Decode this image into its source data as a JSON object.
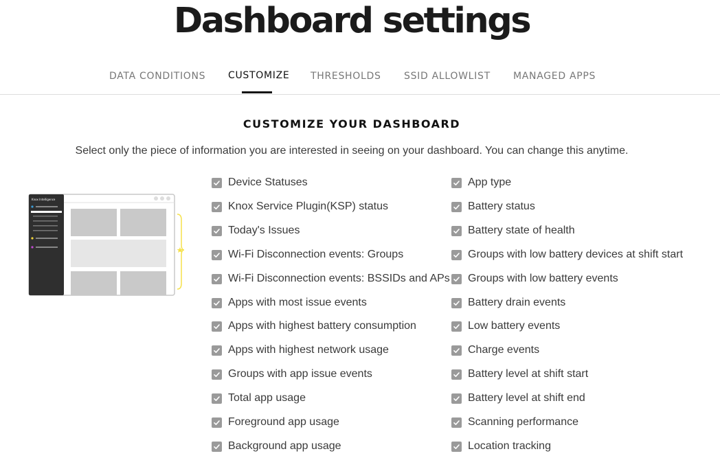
{
  "page": {
    "title": "Dashboard settings"
  },
  "tabs": [
    {
      "label": "DATA CONDITIONS",
      "active": false
    },
    {
      "label": "CUSTOMIZE",
      "active": true
    },
    {
      "label": "THRESHOLDS",
      "active": false
    },
    {
      "label": "SSID ALLOWLIST",
      "active": false
    },
    {
      "label": "MANAGED APPS",
      "active": false
    }
  ],
  "section": {
    "title": "CUSTOMIZE YOUR DASHBOARD",
    "subtitle": "Select only the piece of information you are interested in seeing on your dashboard. You can change this anytime."
  },
  "illustration": {
    "app_label": "Knox Intelligence",
    "icon": "dashboard-preview-icon"
  },
  "options_left": [
    {
      "label": "Device Statuses",
      "checked": true
    },
    {
      "label": "Knox Service Plugin(KSP) status",
      "checked": true
    },
    {
      "label": "Today's Issues",
      "checked": true
    },
    {
      "label": "Wi-Fi Disconnection events: Groups",
      "checked": true
    },
    {
      "label": "Wi-Fi Disconnection events: BSSIDs and APs",
      "checked": true
    },
    {
      "label": "Apps with most issue events",
      "checked": true
    },
    {
      "label": "Apps with highest battery consumption",
      "checked": true
    },
    {
      "label": "Apps with highest network usage",
      "checked": true
    },
    {
      "label": "Groups with app issue events",
      "checked": true
    },
    {
      "label": "Total app usage",
      "checked": true
    },
    {
      "label": "Foreground app usage",
      "checked": true
    },
    {
      "label": "Background app usage",
      "checked": true
    }
  ],
  "options_right": [
    {
      "label": "App type",
      "checked": true
    },
    {
      "label": "Battery status",
      "checked": true
    },
    {
      "label": "Battery state of health",
      "checked": true
    },
    {
      "label": "Groups with low battery devices at shift start",
      "checked": true
    },
    {
      "label": "Groups with low battery events",
      "checked": true
    },
    {
      "label": "Battery drain events",
      "checked": true
    },
    {
      "label": "Low battery events",
      "checked": true
    },
    {
      "label": "Charge events",
      "checked": true
    },
    {
      "label": "Battery level at shift start",
      "checked": true
    },
    {
      "label": "Battery level at shift end",
      "checked": true
    },
    {
      "label": "Scanning performance",
      "checked": true
    },
    {
      "label": "Location tracking",
      "checked": true
    }
  ],
  "colors": {
    "checkbox": "#9a9a9a",
    "active_tab": "#111111",
    "inactive_tab": "#777777",
    "highlight": "#f5e14a"
  }
}
